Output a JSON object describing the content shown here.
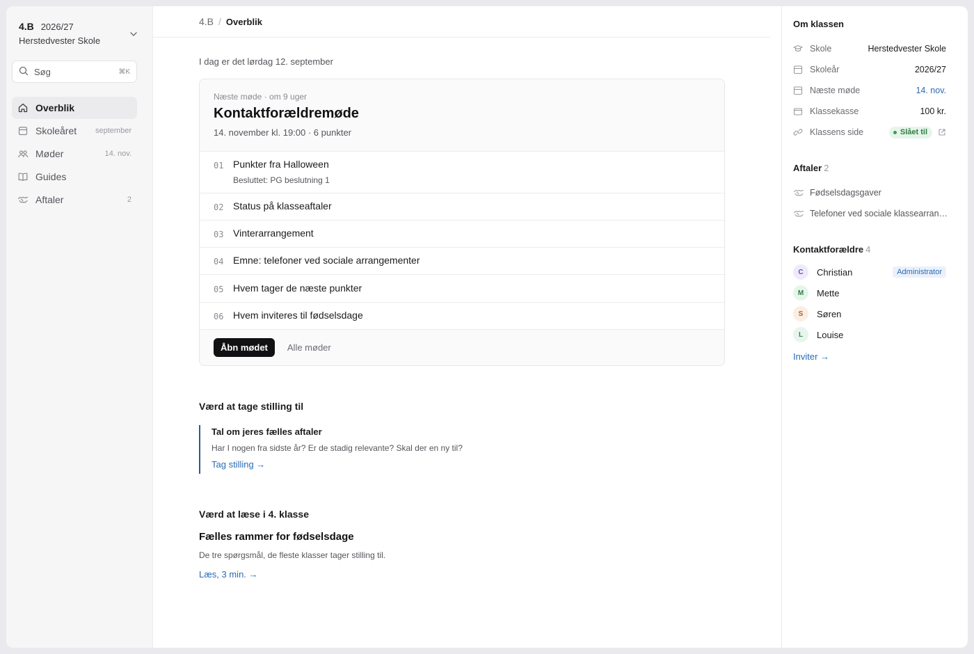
{
  "sidebar": {
    "class_name": "4.B",
    "school_year": "2026/27",
    "school": "Herstedvester Skole",
    "search": {
      "label": "Søg",
      "shortcut": "⌘K"
    },
    "items": [
      {
        "label": "Overblik",
        "meta": "",
        "icon": "home-icon"
      },
      {
        "label": "Skoleåret",
        "meta": "september",
        "icon": "calendar-icon"
      },
      {
        "label": "Møder",
        "meta": "14. nov.",
        "icon": "people-icon"
      },
      {
        "label": "Guides",
        "meta": "",
        "icon": "book-icon"
      },
      {
        "label": "Aftaler",
        "meta": "2",
        "icon": "handshake-icon"
      }
    ]
  },
  "breadcrumb": {
    "parent": "4.B",
    "current": "Overblik"
  },
  "main": {
    "today": "I dag er det lørdag 12. september",
    "meeting": {
      "eyebrow": "Næste møde · om 9 uger",
      "title": "Kontaktforældremøde",
      "subtitle": "14. november kl. 19:00 · 6 punkter",
      "agenda": [
        {
          "num": "01",
          "title": "Punkter fra Halloween",
          "note": "Besluttet: PG beslutning 1"
        },
        {
          "num": "02",
          "title": "Status på klasseaftaler",
          "note": ""
        },
        {
          "num": "03",
          "title": "Vinterarrangement",
          "note": ""
        },
        {
          "num": "04",
          "title": "Emne: telefoner ved sociale arrangementer",
          "note": ""
        },
        {
          "num": "05",
          "title": "Hvem tager de næste punkter",
          "note": ""
        },
        {
          "num": "06",
          "title": "Hvem inviteres til fødselsdage",
          "note": ""
        }
      ],
      "open_button": "Åbn mødet",
      "all_link": "Alle møder"
    },
    "decide": {
      "heading": "Værd at tage stilling til",
      "title": "Tal om jeres fælles aftaler",
      "desc": "Har I nogen fra sidste år? Er de stadig relevante? Skal der en ny til?",
      "link": "Tag stilling →"
    },
    "read": {
      "heading": "Værd at læse i 4. klasse",
      "title": "Fælles rammer for fødselsdage",
      "desc": "De tre spørgsmål, de fleste klasser tager stilling til.",
      "link": "Læs, 3 min. →"
    }
  },
  "right": {
    "about_heading": "Om klassen",
    "info": [
      {
        "key": "Skole",
        "value": "Herstedvester Skole",
        "icon": "graduation-cap-icon"
      },
      {
        "key": "Skoleår",
        "value": "2026/27",
        "icon": "calendar-icon"
      },
      {
        "key": "Næste møde",
        "value": "14. nov.",
        "icon": "calendar-icon"
      },
      {
        "key": "Klassekasse",
        "value": "100 kr.",
        "icon": "wallet-icon"
      },
      {
        "key": "Klassens side",
        "value": "Slået til",
        "icon": "link-icon"
      }
    ],
    "agreements_heading": "Aftaler",
    "agreements_count": "2",
    "agreements": [
      "Fødselsdagsgaver",
      "Telefoner ved sociale klassearrangementer"
    ],
    "parents_heading": "Kontaktforældre",
    "parents_count": "4",
    "parents": [
      {
        "initial": "C",
        "name": "Christian",
        "role": "Administrator",
        "bg": "#efeafa",
        "fg": "#6b4fb3"
      },
      {
        "initial": "M",
        "name": "Mette",
        "role": "",
        "bg": "#e6f5ea",
        "fg": "#2f7d45"
      },
      {
        "initial": "S",
        "name": "Søren",
        "role": "",
        "bg": "#fbeee2",
        "fg": "#b0602a"
      },
      {
        "initial": "L",
        "name": "Louise",
        "role": "",
        "bg": "#e8f5ec",
        "fg": "#3a8a55"
      }
    ],
    "invite": "Inviter →"
  },
  "colors": {
    "accent": "#2a6bb5",
    "primary_button": "#111114",
    "callout_border": "#2c5c8f"
  }
}
